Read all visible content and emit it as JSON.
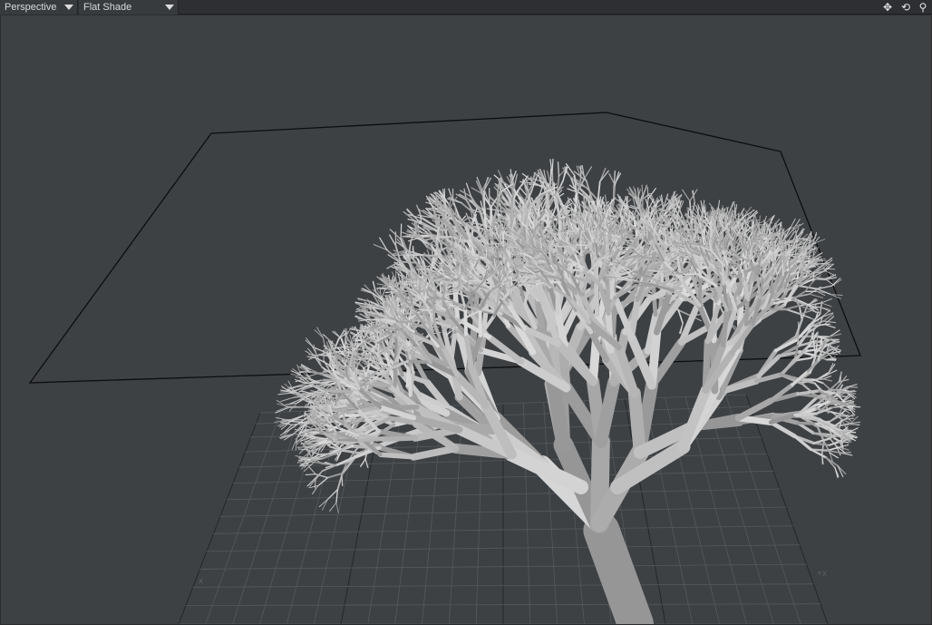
{
  "toolbar": {
    "view_mode": "Perspective",
    "shading_mode": "Flat Shade",
    "buttons": [
      {
        "name": "move-view-icon",
        "glyph": "✥"
      },
      {
        "name": "rotate-view-icon",
        "glyph": "⟲"
      },
      {
        "name": "zoom-view-icon",
        "glyph": "⚲"
      }
    ]
  },
  "viewport": {
    "axis_neg_x": "x",
    "axis_pos_x": "+x"
  },
  "colors": {
    "background": "#3e4144",
    "grid": "#55595c",
    "bounding_box": "#0d0d0d",
    "tree": "#b8b8b8"
  }
}
